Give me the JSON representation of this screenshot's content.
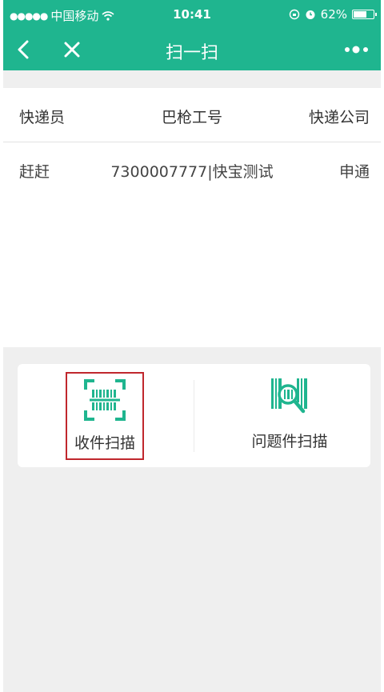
{
  "status_bar": {
    "signal_dots": "●●●●●",
    "carrier": "中国移动",
    "time": "10:41",
    "battery": "62%"
  },
  "nav": {
    "title": "扫一扫",
    "back_icon": "chevron-left-icon",
    "close_icon": "close-icon",
    "more_icon": "more-dots-icon"
  },
  "table": {
    "headers": [
      "快递员",
      "巴枪工号",
      "快递公司"
    ],
    "rows": [
      [
        "赶赶",
        "7300007777|快宝测试",
        "申通"
      ]
    ]
  },
  "actions": [
    {
      "label": "收件扫描",
      "icon": "barcode-scan-icon"
    },
    {
      "label": "问题件扫描",
      "icon": "barcode-search-icon"
    }
  ],
  "colors": {
    "brand": "#1fb58f",
    "highlight": "#c0272d",
    "background": "#efefef"
  }
}
